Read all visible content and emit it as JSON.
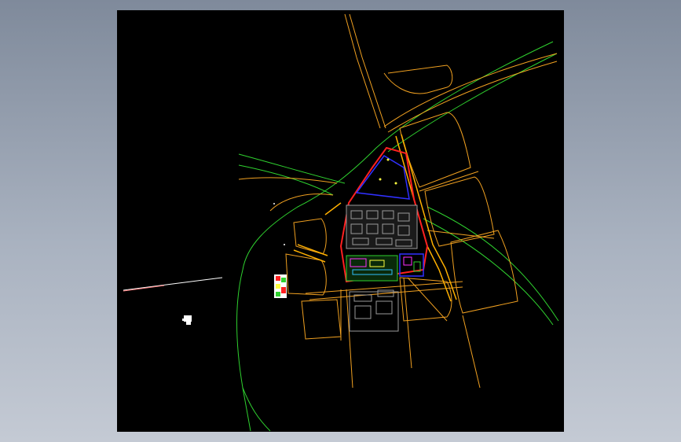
{
  "viewport": {
    "label": "",
    "background": "#000000"
  },
  "colors": {
    "road_orange": "#f0a020",
    "contour_green": "#2fd12f",
    "boundary_red": "#ff2020",
    "inner_blue": "#3030ff",
    "building_grey": "#9a9a9a",
    "magenta": "#ff30ff",
    "yellow": "#ffff40",
    "white": "#ffffff",
    "page_bg": "#8e99a9"
  }
}
